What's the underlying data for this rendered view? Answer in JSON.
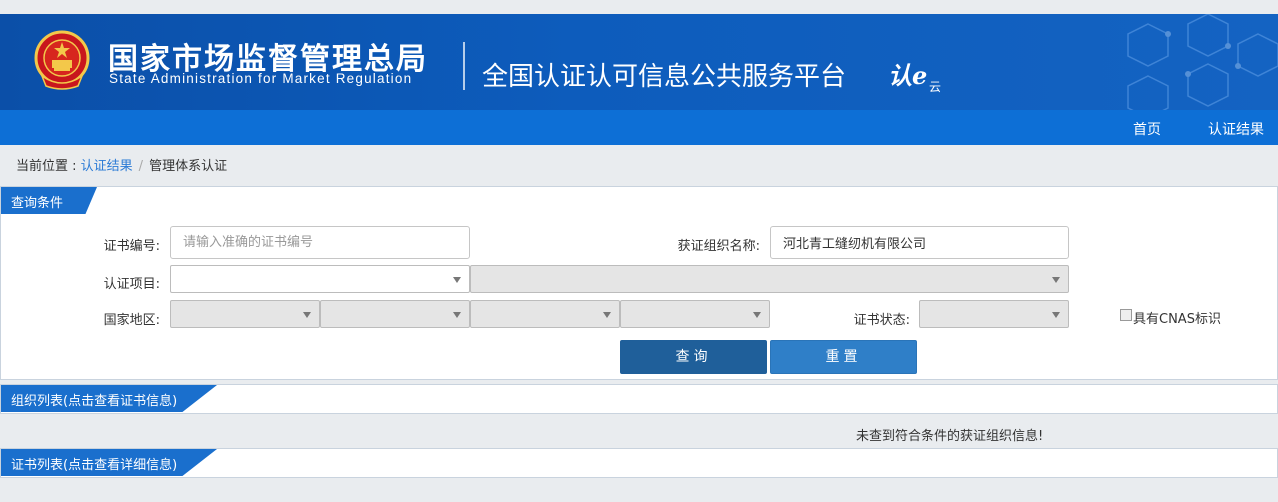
{
  "header": {
    "agency_cn": "国家市场监督管理总局",
    "agency_en": "State Administration  for  Market Regulation",
    "platform_title": "全国认证认可信息公共服务平台",
    "logo_mark": "认e",
    "logo_sub": "云"
  },
  "nav": {
    "home": "首页",
    "results": "认证结果"
  },
  "breadcrumb": {
    "prefix": "当前位置 : ",
    "link": "认证结果",
    "separator": "/",
    "current": "管理体系认证"
  },
  "query": {
    "title": "查询条件",
    "cert_no_label": "证书编号:",
    "cert_no_placeholder": "请输入准确的证书编号",
    "org_name_label": "获证组织名称:",
    "org_name_value": "河北青工缝纫机有限公司",
    "cert_item_label": "认证项目:",
    "region_label": "国家地区:",
    "cert_status_label": "证书状态:",
    "cnas_label": "具有CNAS标识",
    "query_button": "查询",
    "reset_button": "重置"
  },
  "org_list": {
    "title": "组织列表(点击查看证书信息)",
    "empty_message": "未查到符合条件的获证组织信息!"
  },
  "cert_list": {
    "title": "证书列表(点击查看详细信息)"
  },
  "colors": {
    "header_blue": "#0d5cbc",
    "nav_blue": "#0d6fd6",
    "tab_blue": "#1a6fcd",
    "query_button": "#1f5f9a",
    "reset_button": "#2f7fc8"
  }
}
